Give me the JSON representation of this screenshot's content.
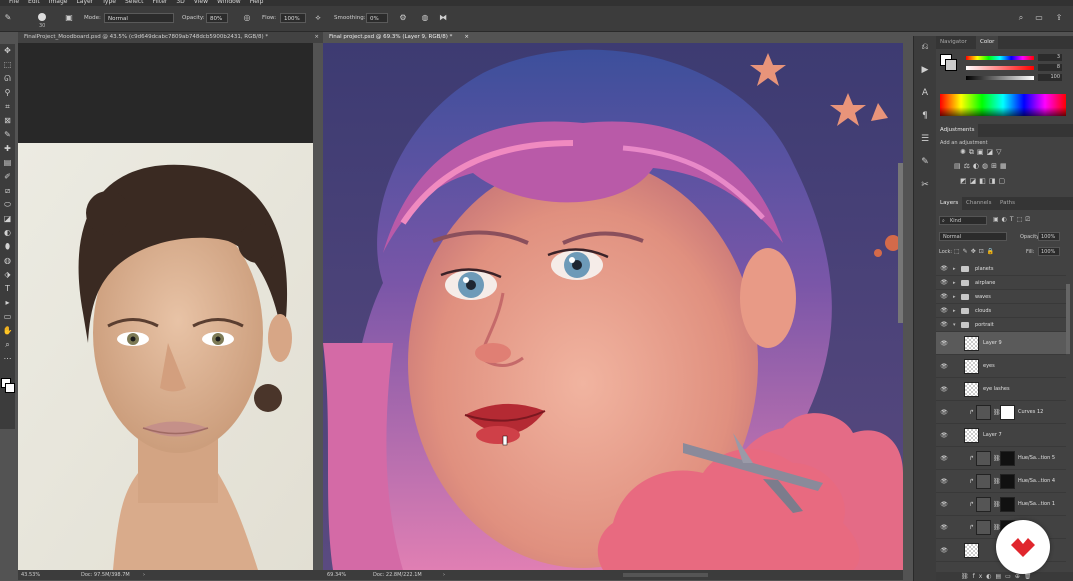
{
  "menu": [
    "File",
    "Edit",
    "Image",
    "Layer",
    "Type",
    "Select",
    "Filter",
    "3D",
    "View",
    "Window",
    "Help"
  ],
  "options": {
    "brush_size": "30",
    "mode_label": "Mode:",
    "mode_value": "Normal",
    "opacity_label": "Opacity:",
    "opacity_value": "80%",
    "flow_label": "Flow:",
    "flow_value": "100%",
    "smoothing_label": "Smoothing:",
    "smoothing_value": "0%"
  },
  "tabs": [
    {
      "label": "FinalProject_Moodboard.psd @ 43.5% (c9d649dcabc7809ab748dcb5900b2431, RGB/8) *",
      "close": "×"
    },
    {
      "label": "Final project.psd @ 69.3% (Layer 9, RGB/8) *",
      "close": "×"
    }
  ],
  "status1": {
    "zoom": "43.53%",
    "doc": "Doc: 97.5M/398.7M",
    "arrow": "›"
  },
  "status2": {
    "zoom": "69.34%",
    "doc": "Doc: 22.8M/222.1M",
    "arrow": "›"
  },
  "tools": [
    "✥",
    "⬚",
    "ᘏ",
    "⚲",
    "⌗",
    "⊠",
    "✎",
    "✚",
    "▤",
    "✐",
    "⧄",
    "⬭",
    "◪",
    "◐",
    "⬮",
    "◍",
    "⬗",
    "T",
    "▸",
    "▭",
    "✋",
    "⌕",
    "⋯"
  ],
  "panels": {
    "navigator_tab": "Navigator",
    "color_tab": "Color",
    "color_values": {
      "h": "3",
      "s": "8",
      "b": "100"
    },
    "adjustments_tab": "Adjustments",
    "adjustments_hint": "Add an adjustment",
    "layers_tab": "Layers",
    "channels_tab": "Channels",
    "paths_tab": "Paths",
    "kind_label": "Kind",
    "blend_mode": "Normal",
    "opacity_label": "Opacity:",
    "opacity_value": "100%",
    "lock_label": "Lock:",
    "fill_label": "Fill:",
    "fill_value": "100%"
  },
  "layers": [
    {
      "name": "planets",
      "type": "group"
    },
    {
      "name": "airplane",
      "type": "group"
    },
    {
      "name": "waves",
      "type": "group"
    },
    {
      "name": "clouds",
      "type": "group"
    },
    {
      "name": "portrait",
      "type": "group",
      "open": true
    },
    {
      "name": "Layer 9",
      "type": "layer",
      "selected": true
    },
    {
      "name": "eyes",
      "type": "layer"
    },
    {
      "name": "eye lashes",
      "type": "layer"
    },
    {
      "name": "Curves 12",
      "type": "adjust"
    },
    {
      "name": "Layer 7",
      "type": "layer"
    },
    {
      "name": "Hue/Sa...tion 5",
      "type": "adjust"
    },
    {
      "name": "Hue/Sa...tion 4",
      "type": "adjust"
    },
    {
      "name": "Hue/Sa...tion 1",
      "type": "adjust"
    },
    {
      "name": "",
      "type": "adjust"
    },
    {
      "name": "",
      "type": "layer"
    }
  ],
  "colors": {
    "accent": "#e0262d",
    "selected_row": "#5a5a5a"
  }
}
